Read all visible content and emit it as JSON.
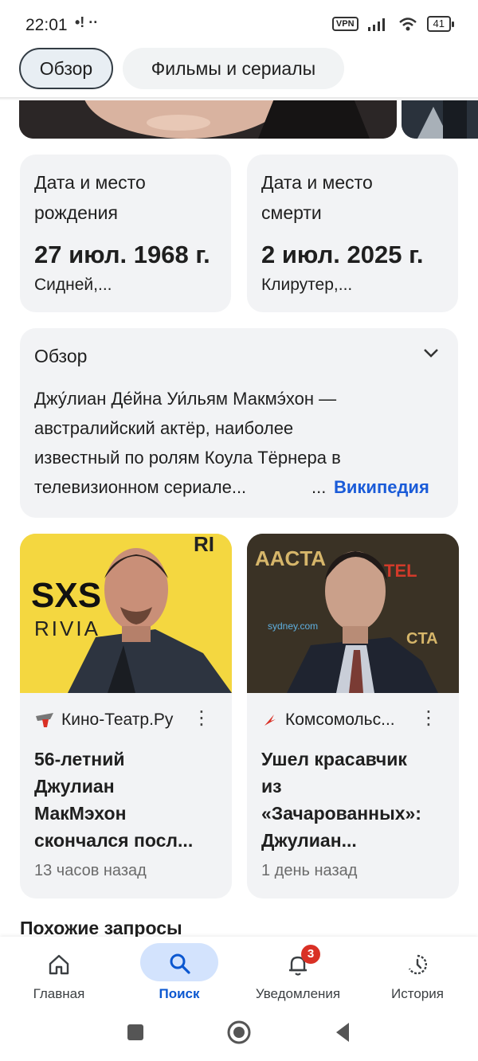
{
  "status_bar": {
    "time": "22:01",
    "time_icons": "•! ··",
    "vpn": "VPN",
    "battery": "41"
  },
  "tabs": [
    {
      "label": "Обзор",
      "selected": true
    },
    {
      "label": "Фильмы и сериалы",
      "selected": false
    }
  ],
  "birth": {
    "label_line1": "Дата и место",
    "label_line2": "рождения",
    "date": "27 июл. 1968 г.",
    "place": "Сидней,..."
  },
  "death": {
    "label_line1": "Дата и место",
    "label_line2": "смерти",
    "date": "2 июл. 2025 г.",
    "place": "Клирутер,..."
  },
  "overview": {
    "heading": "Обзор",
    "lines": [
      "Джу́лиан Де́йна Уи́льям Макмэ́хон —",
      "австралийский актёр, наиболее",
      "известный по ролям Коула Тёрнера в",
      "телевизионном сериале..."
    ],
    "more": "...",
    "source_link": "Википедия"
  },
  "news": [
    {
      "source": "Кино-Театр.Ру",
      "title_lines": [
        "56-летний",
        "Джулиан",
        "МакМэхон",
        "скончался посл..."
      ],
      "time": "13 часов назад",
      "image_texts": [
        "SXS",
        "RIVIA",
        "RI"
      ]
    },
    {
      "source": "Комсомольс...",
      "title_lines": [
        "Ушел красавчик",
        "из",
        "«Зачарованных»:",
        "Джулиан..."
      ],
      "time": "1 день назад",
      "image_texts": [
        "AACTA",
        "TEL",
        "sydney.com",
        "CTA"
      ]
    }
  ],
  "related_heading": "Похожие запросы",
  "bottom_nav": [
    {
      "label": "Главная",
      "icon": "home-icon",
      "active": false
    },
    {
      "label": "Поиск",
      "icon": "search-icon",
      "active": true
    },
    {
      "label": "Уведомления",
      "icon": "bell-icon",
      "active": false,
      "badge": "3"
    },
    {
      "label": "История",
      "icon": "history-icon",
      "active": false
    }
  ],
  "colors": {
    "accent": "#1a5bd8",
    "card_bg": "#f2f3f5",
    "badge": "#d93025",
    "active_pill": "#d3e3fd"
  }
}
